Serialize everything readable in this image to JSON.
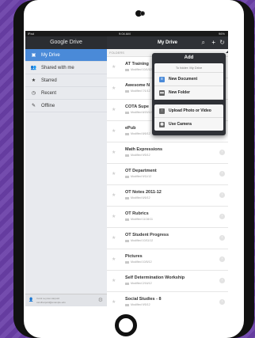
{
  "status": {
    "carrier": "iPad",
    "time": "9:04 AM",
    "battery": "96%"
  },
  "sidebar": {
    "title": "Google Drive",
    "items": [
      {
        "label": "My Drive",
        "icon": "drive-icon"
      },
      {
        "label": "Shared with me",
        "icon": "people-icon"
      },
      {
        "label": "Starred",
        "icon": "star-icon"
      },
      {
        "label": "Recent",
        "icon": "clock-icon"
      },
      {
        "label": "Offline",
        "icon": "pin-icon"
      }
    ],
    "account_name": "Carol Leynse Harpold",
    "account_email": "carolharpold@example.edu"
  },
  "main": {
    "title": "My Drive",
    "folders_label": "FOLDERS",
    "rows": [
      {
        "name": "AT Training",
        "modified": "Modified 10/1/12"
      },
      {
        "name": "Awesome N",
        "modified": "Modified 7/1/12"
      },
      {
        "name": "COTA Supe",
        "modified": "Modified 8/20/12"
      },
      {
        "name": "ePub",
        "modified": "Modified 8/6/12"
      },
      {
        "name": "Math Expressions",
        "modified": "Modified 9/5/12"
      },
      {
        "name": "OT Department",
        "modified": "Modified 9/11/12"
      },
      {
        "name": "OT Notes 2011-12",
        "modified": "Modified 6/6/12"
      },
      {
        "name": "OT Rubrics",
        "modified": "Modified 11/16/11"
      },
      {
        "name": "OT Student Progress",
        "modified": "Modified 10/11/12"
      },
      {
        "name": "Pictures",
        "modified": "Modified 10/5/12"
      },
      {
        "name": "Self Determination Workship",
        "modified": "Modified 2/16/12"
      },
      {
        "name": "Social Studies - 8",
        "modified": "Modified 9/5/12"
      }
    ]
  },
  "popup": {
    "title": "Add",
    "folder_line": "To folder: My Drive",
    "items": [
      {
        "label": "New Document",
        "icon": "document-icon",
        "color": "#4a8ad8"
      },
      {
        "label": "New Folder",
        "icon": "folder-icon",
        "color": "#666666"
      },
      {
        "label": "Upload Photo or Video",
        "icon": "upload-icon",
        "color": "#666666"
      },
      {
        "label": "Use Camera",
        "icon": "camera-icon",
        "color": "#666666"
      }
    ]
  }
}
